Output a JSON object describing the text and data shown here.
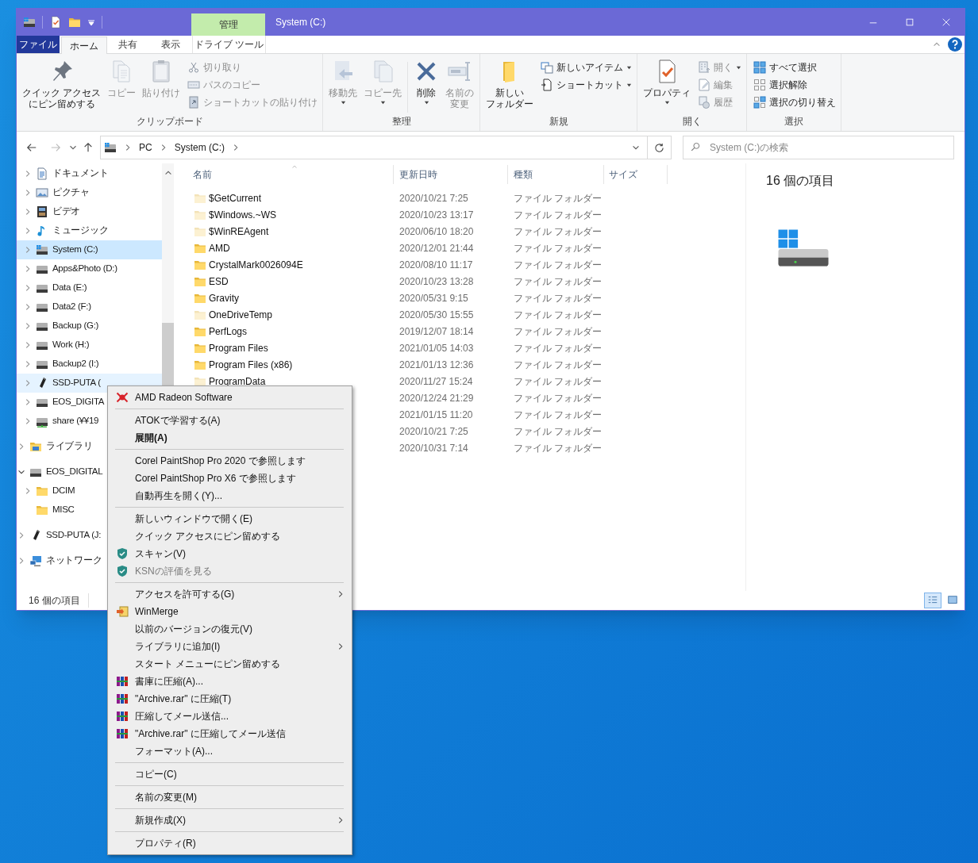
{
  "window": {
    "title": "System (C:)"
  },
  "ribbon": {
    "file_tab": "ファイル",
    "tabs": [
      {
        "label": "ホーム",
        "selected": true
      },
      {
        "label": "共有",
        "selected": false
      },
      {
        "label": "表示",
        "selected": false
      }
    ],
    "context_tab": {
      "group": "管理",
      "label": "ドライブ ツール",
      "selected": false
    },
    "groups": [
      {
        "label": "クリップボード",
        "buttons": [
          {
            "kind": "large",
            "lines": [
              "クイック アクセス",
              "にピン留めする"
            ],
            "disabled": false,
            "dropdown": false
          },
          {
            "kind": "large",
            "lines": [
              "コピー"
            ],
            "disabled": true,
            "dropdown": false
          },
          {
            "kind": "large",
            "lines": [
              "貼り付け"
            ],
            "disabled": true,
            "dropdown": false
          },
          {
            "kind": "small",
            "lines": [
              "切り取り"
            ],
            "disabled": true,
            "dropdown": false
          },
          {
            "kind": "small",
            "lines": [
              "パスのコピー"
            ],
            "disabled": true,
            "dropdown": false
          },
          {
            "kind": "small",
            "lines": [
              "ショートカットの貼り付け"
            ],
            "disabled": true,
            "dropdown": false
          }
        ]
      },
      {
        "label": "整理",
        "buttons": [
          {
            "kind": "large",
            "lines": [
              "移動先"
            ],
            "disabled": true,
            "dropdown": true
          },
          {
            "kind": "large",
            "lines": [
              "コピー先"
            ],
            "disabled": true,
            "dropdown": true
          },
          {
            "kind": "separator"
          },
          {
            "kind": "large",
            "lines": [
              "削除"
            ],
            "disabled": false,
            "dropdown": true
          },
          {
            "kind": "large",
            "lines": [
              "名前の",
              "変更"
            ],
            "disabled": true,
            "dropdown": false
          }
        ]
      },
      {
        "label": "新規",
        "buttons": [
          {
            "kind": "large",
            "lines": [
              "新しい",
              "フォルダー"
            ],
            "disabled": false,
            "dropdown": false
          },
          {
            "kind": "small",
            "lines": [
              "新しいアイテム"
            ],
            "disabled": false,
            "dropdown": true
          },
          {
            "kind": "small",
            "lines": [
              "ショートカット"
            ],
            "disabled": false,
            "dropdown": true
          }
        ]
      },
      {
        "label": "開く",
        "buttons": [
          {
            "kind": "large",
            "lines": [
              "プロパティ"
            ],
            "disabled": false,
            "dropdown": true
          },
          {
            "kind": "small",
            "lines": [
              "開く"
            ],
            "disabled": true,
            "dropdown": true
          },
          {
            "kind": "small",
            "lines": [
              "編集"
            ],
            "disabled": true,
            "dropdown": false
          },
          {
            "kind": "small",
            "lines": [
              "履歴"
            ],
            "disabled": true,
            "dropdown": false
          }
        ]
      },
      {
        "label": "選択",
        "buttons": [
          {
            "kind": "small",
            "lines": [
              "すべて選択"
            ],
            "disabled": false,
            "dropdown": false
          },
          {
            "kind": "small",
            "lines": [
              "選択解除"
            ],
            "disabled": false,
            "dropdown": false
          },
          {
            "kind": "small",
            "lines": [
              "選択の切り替え"
            ],
            "disabled": false,
            "dropdown": false
          }
        ]
      }
    ]
  },
  "address_bar": {
    "path": [
      "PC",
      "System (C:)"
    ],
    "search_placeholder": "System (C:)の検索"
  },
  "nav": {
    "pc_children": [
      {
        "label": "ドキュメント",
        "kind": "documents",
        "selected": false,
        "hovered": false,
        "expandable": true,
        "expanded": false
      },
      {
        "label": "ピクチャ",
        "kind": "pictures",
        "selected": false,
        "hovered": false,
        "expandable": true,
        "expanded": false
      },
      {
        "label": "ビデオ",
        "kind": "videos",
        "selected": false,
        "hovered": false,
        "expandable": true,
        "expanded": false
      },
      {
        "label": "ミュージック",
        "kind": "music",
        "selected": false,
        "hovered": false,
        "expandable": true,
        "expanded": false
      },
      {
        "label": "System (C:)",
        "kind": "system-drive",
        "selected": true,
        "hovered": false,
        "expandable": true,
        "expanded": false
      },
      {
        "label": "Apps&Photo (D:)",
        "kind": "drive",
        "selected": false,
        "hovered": false,
        "expandable": true,
        "expanded": false
      },
      {
        "label": "Data (E:)",
        "kind": "drive",
        "selected": false,
        "hovered": false,
        "expandable": true,
        "expanded": false
      },
      {
        "label": "Data2 (F:)",
        "kind": "drive",
        "selected": false,
        "hovered": false,
        "expandable": true,
        "expanded": false
      },
      {
        "label": "Backup (G:)",
        "kind": "drive",
        "selected": false,
        "hovered": false,
        "expandable": true,
        "expanded": false
      },
      {
        "label": "Work (H:)",
        "kind": "drive",
        "selected": false,
        "hovered": false,
        "expandable": true,
        "expanded": false
      },
      {
        "label": "Backup2 (I:)",
        "kind": "drive",
        "selected": false,
        "hovered": false,
        "expandable": true,
        "expanded": false
      },
      {
        "label": "SSD-PUTA (",
        "kind": "usb",
        "selected": false,
        "hovered": true,
        "expandable": true,
        "expanded": false
      },
      {
        "label": "EOS_DIGITA",
        "kind": "drive",
        "selected": false,
        "hovered": false,
        "expandable": true,
        "expanded": false
      },
      {
        "label": "share (¥¥19",
        "kind": "network-drive",
        "selected": false,
        "hovered": false,
        "expandable": true,
        "expanded": false
      }
    ],
    "items": [
      {
        "label": "ライブラリ",
        "kind": "library",
        "selected": false,
        "hovered": false,
        "expandable": true,
        "expanded": false
      },
      {
        "label": "EOS_DIGITAL",
        "kind": "drive",
        "selected": false,
        "hovered": false,
        "expandable": true,
        "expanded": true,
        "children": [
          {
            "label": "DCIM",
            "kind": "folder",
            "selected": false,
            "hovered": false,
            "expandable": true,
            "expanded": false
          },
          {
            "label": "MISC",
            "kind": "folder",
            "selected": false,
            "hovered": false,
            "expandable": false,
            "expanded": false
          }
        ]
      },
      {
        "label": "SSD-PUTA (J:",
        "kind": "usb",
        "selected": false,
        "hovered": false,
        "expandable": true,
        "expanded": false
      },
      {
        "label": "ネットワーク",
        "kind": "network",
        "selected": false,
        "hovered": false,
        "expandable": true,
        "expanded": false
      }
    ]
  },
  "file_list": {
    "columns": [
      {
        "label": "名前",
        "sorted": true
      },
      {
        "label": "更新日時",
        "sorted": false
      },
      {
        "label": "種類",
        "sorted": false
      },
      {
        "label": "サイズ",
        "sorted": false
      }
    ],
    "rows": [
      {
        "name": "$GetCurrent",
        "hidden": true,
        "date": "2020/10/21 7:25",
        "type": "ファイル フォルダー"
      },
      {
        "name": "$Windows.~WS",
        "hidden": true,
        "date": "2020/10/23 13:17",
        "type": "ファイル フォルダー"
      },
      {
        "name": "$WinREAgent",
        "hidden": true,
        "date": "2020/06/10 18:20",
        "type": "ファイル フォルダー"
      },
      {
        "name": "AMD",
        "hidden": false,
        "date": "2020/12/01 21:44",
        "type": "ファイル フォルダー"
      },
      {
        "name": "CrystalMark0026094E",
        "hidden": false,
        "date": "2020/08/10 11:17",
        "type": "ファイル フォルダー"
      },
      {
        "name": "ESD",
        "hidden": false,
        "date": "2020/10/23 13:28",
        "type": "ファイル フォルダー"
      },
      {
        "name": "Gravity",
        "hidden": false,
        "date": "2020/05/31 9:15",
        "type": "ファイル フォルダー"
      },
      {
        "name": "OneDriveTemp",
        "hidden": true,
        "date": "2020/05/30 15:55",
        "type": "ファイル フォルダー"
      },
      {
        "name": "PerfLogs",
        "hidden": false,
        "date": "2019/12/07 18:14",
        "type": "ファイル フォルダー"
      },
      {
        "name": "Program Files",
        "hidden": false,
        "date": "2021/01/05 14:03",
        "type": "ファイル フォルダー"
      },
      {
        "name": "Program Files (x86)",
        "hidden": false,
        "date": "2021/01/13 12:36",
        "type": "ファイル フォルダー"
      },
      {
        "name": "ProgramData",
        "hidden": true,
        "date": "2020/11/27 15:24",
        "type": "ファイル フォルダー"
      },
      {
        "date": "2020/12/24 21:29",
        "type": "ファイル フォルダー"
      },
      {
        "date": "2021/01/15 11:20",
        "type": "ファイル フォルダー"
      },
      {
        "date": "2020/10/21 7:25",
        "type": "ファイル フォルダー"
      },
      {
        "date": "2020/10/31 7:14",
        "type": "ファイル フォルダー"
      }
    ]
  },
  "details_pane": {
    "count": "16 個の項目"
  },
  "status_bar": {
    "count": "16 個の項目",
    "views": [
      {
        "kind": "details",
        "selected": true
      },
      {
        "kind": "large-icons",
        "selected": false
      }
    ]
  },
  "context_menu": [
    {
      "kind": "amd",
      "label": "AMD Radeon Software",
      "default": false,
      "disabled": false,
      "submenu": false
    },
    {
      "kind": "separator"
    },
    {
      "kind": "plain",
      "label": "ATOKで学習する(A)",
      "default": false,
      "disabled": false,
      "submenu": false
    },
    {
      "kind": "plain",
      "label": "展開(A)",
      "default": true,
      "disabled": false,
      "submenu": false
    },
    {
      "kind": "separator"
    },
    {
      "kind": "plain",
      "label": "Corel PaintShop Pro 2020 で参照します",
      "default": false,
      "disabled": false,
      "submenu": false
    },
    {
      "kind": "plain",
      "label": "Corel PaintShop Pro X6 で参照します",
      "default": false,
      "disabled": false,
      "submenu": false
    },
    {
      "kind": "plain",
      "label": "自動再生を開く(Y)...",
      "default": false,
      "disabled": false,
      "submenu": false
    },
    {
      "kind": "separator"
    },
    {
      "kind": "plain",
      "label": "新しいウィンドウで開く(E)",
      "default": false,
      "disabled": false,
      "submenu": false
    },
    {
      "kind": "plain",
      "label": "クイック アクセスにピン留めする",
      "default": false,
      "disabled": false,
      "submenu": false
    },
    {
      "kind": "shield",
      "label": "スキャン(V)",
      "default": false,
      "disabled": false,
      "submenu": false
    },
    {
      "kind": "shield",
      "label": "KSNの評価を見る",
      "default": false,
      "disabled": true,
      "submenu": false
    },
    {
      "kind": "separator"
    },
    {
      "kind": "plain",
      "label": "アクセスを許可する(G)",
      "default": false,
      "disabled": false,
      "submenu": true
    },
    {
      "kind": "winmerge",
      "label": "WinMerge",
      "default": false,
      "disabled": false,
      "submenu": false
    },
    {
      "kind": "plain",
      "label": "以前のバージョンの復元(V)",
      "default": false,
      "disabled": false,
      "submenu": false
    },
    {
      "kind": "plain",
      "label": "ライブラリに追加(I)",
      "default": false,
      "disabled": false,
      "submenu": true
    },
    {
      "kind": "plain",
      "label": "スタート メニューにピン留めする",
      "default": false,
      "disabled": false,
      "submenu": false
    },
    {
      "kind": "rar",
      "label": "書庫に圧縮(A)...",
      "default": false,
      "disabled": false,
      "submenu": false
    },
    {
      "kind": "rar",
      "label": "\"Archive.rar\" に圧縮(T)",
      "default": false,
      "disabled": false,
      "submenu": false
    },
    {
      "kind": "rar",
      "label": "圧縮してメール送信...",
      "default": false,
      "disabled": false,
      "submenu": false
    },
    {
      "kind": "rar",
      "label": "\"Archive.rar\" に圧縮してメール送信",
      "default": false,
      "disabled": false,
      "submenu": false
    },
    {
      "kind": "plain",
      "label": "フォーマット(A)...",
      "default": false,
      "disabled": false,
      "submenu": false
    },
    {
      "kind": "separator"
    },
    {
      "kind": "plain",
      "label": "コピー(C)",
      "default": false,
      "disabled": false,
      "submenu": false
    },
    {
      "kind": "separator"
    },
    {
      "kind": "plain",
      "label": "名前の変更(M)",
      "default": false,
      "disabled": false,
      "submenu": false
    },
    {
      "kind": "separator"
    },
    {
      "kind": "plain",
      "label": "新規作成(X)",
      "default": false,
      "disabled": false,
      "submenu": true
    },
    {
      "kind": "separator"
    },
    {
      "kind": "plain",
      "label": "プロパティ(R)",
      "default": false,
      "disabled": false,
      "submenu": false
    }
  ]
}
